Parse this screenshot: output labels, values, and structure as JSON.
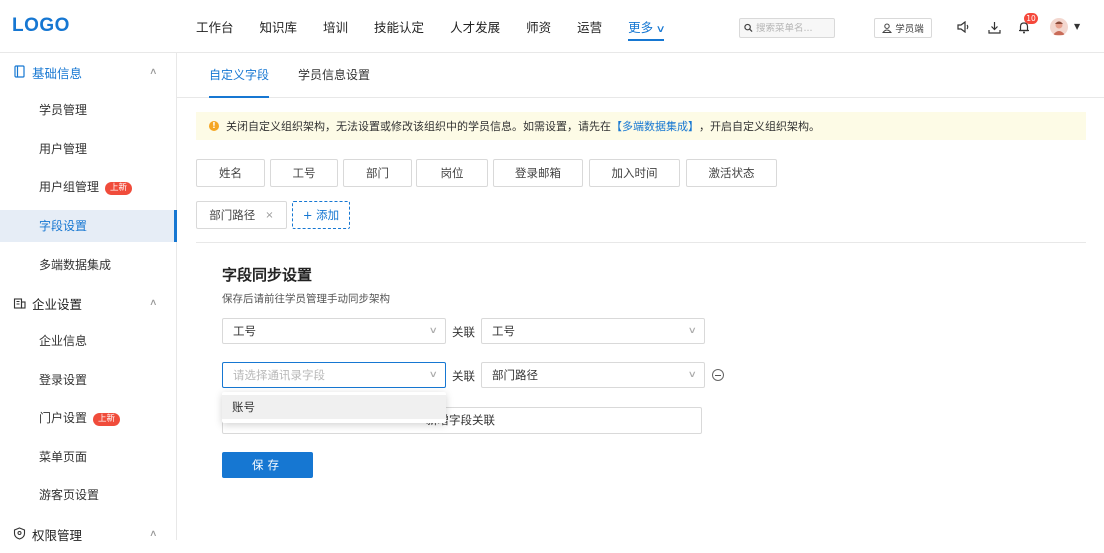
{
  "app": {
    "logo": "LOGO"
  },
  "nav": {
    "items": [
      "工作台",
      "知识库",
      "培训",
      "技能认定",
      "人才发展",
      "师资",
      "运营",
      "更多"
    ]
  },
  "search": {
    "placeholder": "搜索菜单名..."
  },
  "topbar": {
    "student_label": "学员端",
    "notification_count": "10"
  },
  "sidebar": {
    "groups": [
      {
        "label": "基础信息",
        "items": [
          "学员管理",
          "用户管理",
          "用户组管理",
          "字段设置",
          "多端数据集成"
        ]
      },
      {
        "label": "企业设置",
        "items": [
          "企业信息",
          "登录设置",
          "门户设置",
          "菜单页面",
          "游客页设置"
        ]
      },
      {
        "label": "权限管理"
      }
    ],
    "new_tag": "上新"
  },
  "tabs": [
    "自定义字段",
    "学员信息设置"
  ],
  "notice": {
    "text_before": "关闭自定义组织架构，无法设置或修改该组织中的学员信息。如需设置，请先在",
    "link": "【多端数据集成】",
    "text_after": "，开启自定义组织架构。"
  },
  "fields": [
    "姓名",
    "工号",
    "部门",
    "岗位",
    "登录邮箱",
    "加入时间",
    "激活状态",
    "部门路径"
  ],
  "add_field_label": "+ 添加",
  "sync": {
    "title": "字段同步设置",
    "subtitle": "保存后请前往学员管理手动同步架构",
    "relate_label": "关联",
    "row1": {
      "left": "工号",
      "right": "工号"
    },
    "row2": {
      "left_placeholder": "请选择通讯录字段",
      "right": "部门路径"
    },
    "dropdown_option": "账号",
    "add_relation": "新增字段关联",
    "save": "保存"
  },
  "colors": {
    "primary": "#1677d2",
    "new_tag": "#f04c3b",
    "notice_bg": "#fdfbe6"
  }
}
